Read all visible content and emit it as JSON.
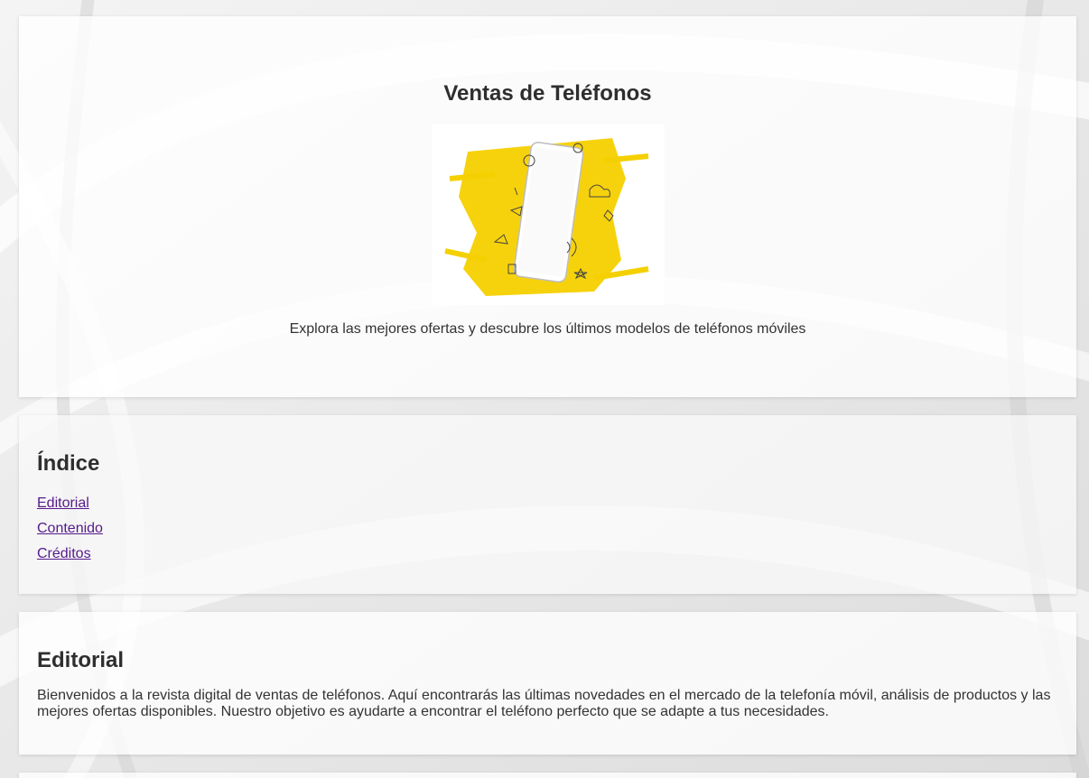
{
  "header": {
    "title": "Ventas de Teléfonos",
    "tagline": "Explora las mejores ofertas y descubre los últimos modelos de teléfonos móviles",
    "hero_image": "phone-illustration",
    "accent_color": "#f5d000"
  },
  "index": {
    "heading": "Índice",
    "links": [
      {
        "label": "Editorial"
      },
      {
        "label": "Contenido"
      },
      {
        "label": "Créditos"
      }
    ],
    "link_color": "#551a8b"
  },
  "editorial": {
    "heading": "Editorial",
    "text": "Bienvenidos a la revista digital de ventas de teléfonos. Aquí encontrarás las últimas novedades en el mercado de la telefonía móvil, análisis de productos y las mejores ofertas disponibles. Nuestro objetivo es ayudarte a encontrar el teléfono perfecto que se adapte a tus necesidades."
  }
}
